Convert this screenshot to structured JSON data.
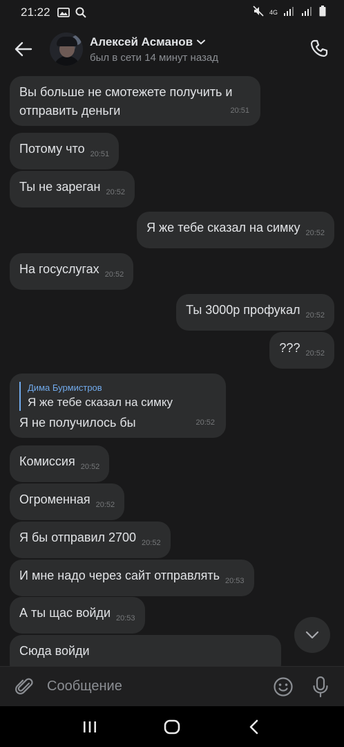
{
  "status_bar": {
    "time": "21:22",
    "network": "4G"
  },
  "header": {
    "name": "Алексей Асманов",
    "status": "был в сети 14 минут назад"
  },
  "messages": [
    {
      "side": "in",
      "lines": [
        "Вы больше не смотежете получить и",
        "отправить деньги"
      ],
      "time": "20:51"
    },
    {
      "side": "in",
      "text": "Потому что",
      "time": "20:51"
    },
    {
      "side": "in",
      "text": "Ты не зареган",
      "time": "20:52"
    },
    {
      "side": "out",
      "text": "Я же тебе сказал на симку",
      "time": "20:52"
    },
    {
      "side": "in",
      "text": "На госуслугах",
      "time": "20:52"
    },
    {
      "side": "out",
      "text": "Ты 3000р профукал",
      "time": "20:52"
    },
    {
      "side": "out",
      "text": "???",
      "time": "20:52"
    },
    {
      "side": "in",
      "reply": {
        "name": "Дима Бурмистров",
        "text": "Я же тебе сказал на симку"
      },
      "text": "Я не получилось бы",
      "time": "20:52"
    },
    {
      "side": "in",
      "text": "Комиссия",
      "time": "20:52"
    },
    {
      "side": "in",
      "text": "Огроменная",
      "time": "20:52"
    },
    {
      "side": "in",
      "text": "Я бы отправил 2700",
      "time": "20:52"
    },
    {
      "side": "in",
      "text": "И мне надо через сайт отправлять",
      "time": "20:53"
    },
    {
      "side": "in",
      "text": "А ты щас войди",
      "time": "20:53"
    },
    {
      "side": "in",
      "text": "Сюда войди",
      "time": ""
    }
  ],
  "composer": {
    "placeholder": "Сообщение"
  },
  "colors": {
    "bubble": "#2c2d2e",
    "background": "#19191a",
    "accent": "#71aaeb"
  }
}
